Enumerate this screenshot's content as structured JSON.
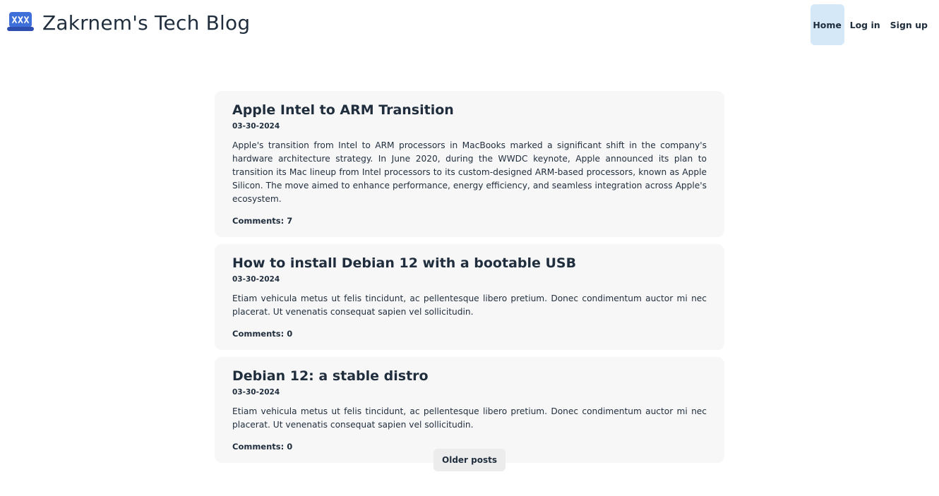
{
  "header": {
    "logo_icon": "laptop-password-icon",
    "logo_text": "***",
    "site_title": "Zakrnem's Tech Blog",
    "nav": {
      "home": "Home",
      "login": "Log in",
      "signup": "Sign up"
    },
    "accent_color": "#d5e8f7",
    "logo_color": "#3f5fc7"
  },
  "posts": [
    {
      "title": "Apple Intel to ARM Transition",
      "date": "03-30-2024",
      "body": "Apple's transition from Intel to ARM processors in MacBooks marked a significant shift in the company's hardware architecture strategy. In June 2020, during the WWDC keynote, Apple announced its plan to transition its Mac lineup from Intel processors to its custom-designed ARM-based processors, known as Apple Silicon. The move aimed to enhance performance, energy efficiency, and seamless integration across Apple's ecosystem.",
      "comments": "Comments: 7"
    },
    {
      "title": "How to install Debian 12 with a bootable USB",
      "date": "03-30-2024",
      "body": "Etiam vehicula metus ut felis tincidunt, ac pellentesque libero pretium. Donec condimentum auctor mi nec placerat. Ut venenatis consequat sapien vel sollicitudin.",
      "comments": "Comments: 0"
    },
    {
      "title": "Debian 12: a stable distro",
      "date": "03-30-2024",
      "body": "Etiam vehicula metus ut felis tincidunt, ac pellentesque libero pretium. Donec condimentum auctor mi nec placerat. Ut venenatis consequat sapien vel sollicitudin.",
      "comments": "Comments: 0"
    }
  ],
  "pagination": {
    "older_label": "Older posts"
  }
}
